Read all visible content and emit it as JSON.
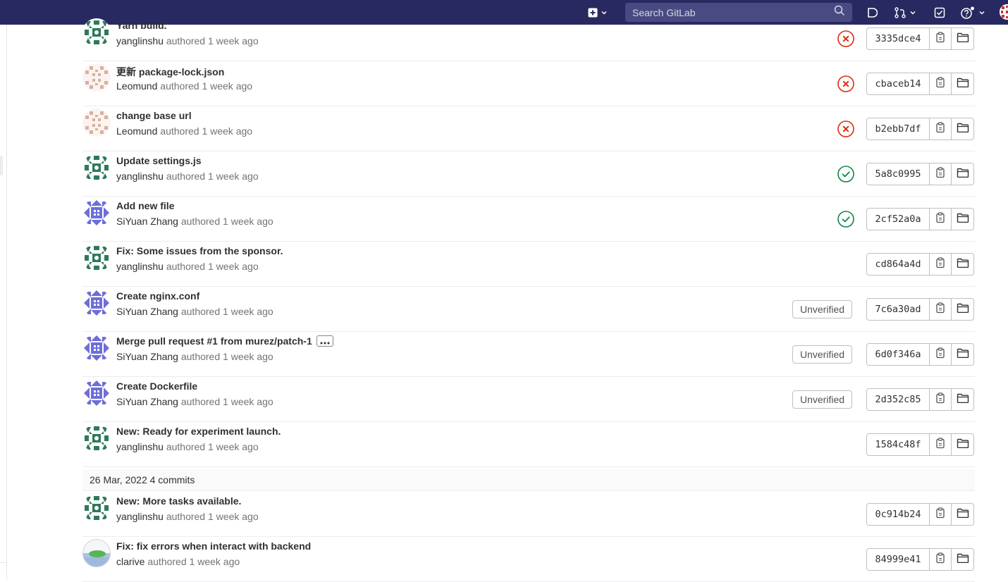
{
  "search": {
    "placeholder": "Search GitLab"
  },
  "colors": {
    "navbar": "#292961",
    "failed": "#dd2b0e",
    "passed": "#108548",
    "avatar_green": "#2e7a58",
    "avatar_beige": "#d8b0a0",
    "avatar_purple": "#6e6ed8"
  },
  "icons": {
    "new": "plus-square-icon",
    "search": "search-icon",
    "issues": "issues-icon",
    "merge_requests": "merge-request-icon",
    "todos": "todo-checkbox-icon",
    "help": "help-icon",
    "copy": "copy-icon",
    "browse": "folder-icon",
    "failed": "status-failed-icon",
    "passed": "status-success-icon"
  },
  "commits_group_1": [
    {
      "title": "Yarn build.",
      "author": "yanglinshu",
      "authored": "authored",
      "time": "1 week ago",
      "status": "failed",
      "badge": "",
      "sha": "3335dce4",
      "avatar": "green"
    },
    {
      "title": "更新 package-lock.json",
      "author": "Leomund",
      "authored": "authored",
      "time": "1 week ago",
      "status": "failed",
      "badge": "",
      "sha": "cbaceb14",
      "avatar": "beige"
    },
    {
      "title": "change base url",
      "author": "Leomund",
      "authored": "authored",
      "time": "1 week ago",
      "status": "failed",
      "badge": "",
      "sha": "b2ebb7df",
      "avatar": "beige"
    },
    {
      "title": "Update settings.js",
      "author": "yanglinshu",
      "authored": "authored",
      "time": "1 week ago",
      "status": "passed",
      "badge": "",
      "sha": "5a8c0995",
      "avatar": "green"
    },
    {
      "title": "Add new file",
      "author": "SiYuan Zhang",
      "authored": "authored",
      "time": "1 week ago",
      "status": "passed",
      "badge": "",
      "sha": "2cf52a0a",
      "avatar": "purple"
    },
    {
      "title": "Fix: Some issues from the sponsor.",
      "author": "yanglinshu",
      "authored": "authored",
      "time": "1 week ago",
      "status": "",
      "badge": "",
      "sha": "cd864a4d",
      "avatar": "green"
    },
    {
      "title": "Create nginx.conf",
      "author": "SiYuan Zhang",
      "authored": "authored",
      "time": "1 week ago",
      "status": "",
      "badge": "Unverified",
      "sha": "7c6a30ad",
      "avatar": "purple"
    },
    {
      "title": "Merge pull request #1 from murez/patch-1",
      "author": "SiYuan Zhang",
      "authored": "authored",
      "time": "1 week ago",
      "status": "",
      "badge": "Unverified",
      "sha": "6d0f346a",
      "avatar": "purple",
      "has_more": true
    },
    {
      "title": "Create Dockerfile",
      "author": "SiYuan Zhang",
      "authored": "authored",
      "time": "1 week ago",
      "status": "",
      "badge": "Unverified",
      "sha": "2d352c85",
      "avatar": "purple"
    },
    {
      "title": "New: Ready for experiment launch.",
      "author": "yanglinshu",
      "authored": "authored",
      "time": "1 week ago",
      "status": "",
      "badge": "",
      "sha": "1584c48f",
      "avatar": "green"
    }
  ],
  "day_header": {
    "date": "26 Mar, 2022",
    "count": "4 commits"
  },
  "commits_group_2": [
    {
      "title": "New: More tasks available.",
      "author": "yanglinshu",
      "authored": "authored",
      "time": "1 week ago",
      "status": "",
      "badge": "",
      "sha": "0c914b24",
      "avatar": "green"
    },
    {
      "title": "Fix: fix errors when interact with backend",
      "author": "clarive",
      "authored": "authored",
      "time": "1 week ago",
      "status": "",
      "badge": "",
      "sha": "84999e41",
      "avatar": "photo"
    }
  ]
}
